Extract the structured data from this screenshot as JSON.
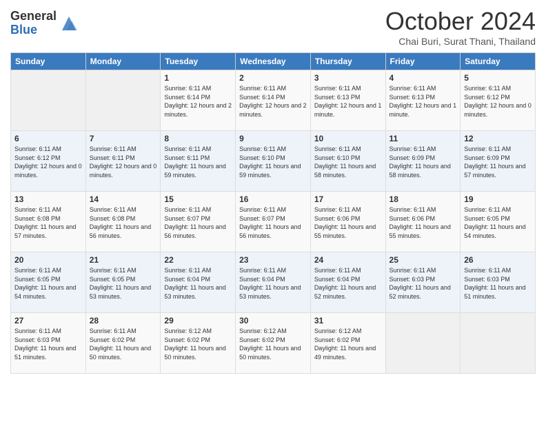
{
  "header": {
    "logo_general": "General",
    "logo_blue": "Blue",
    "month_title": "October 2024",
    "subtitle": "Chai Buri, Surat Thani, Thailand"
  },
  "weekdays": [
    "Sunday",
    "Monday",
    "Tuesday",
    "Wednesday",
    "Thursday",
    "Friday",
    "Saturday"
  ],
  "weeks": [
    [
      {
        "day": "",
        "info": ""
      },
      {
        "day": "",
        "info": ""
      },
      {
        "day": "1",
        "info": "Sunrise: 6:11 AM\nSunset: 6:14 PM\nDaylight: 12 hours and 2 minutes."
      },
      {
        "day": "2",
        "info": "Sunrise: 6:11 AM\nSunset: 6:14 PM\nDaylight: 12 hours and 2 minutes."
      },
      {
        "day": "3",
        "info": "Sunrise: 6:11 AM\nSunset: 6:13 PM\nDaylight: 12 hours and 1 minute."
      },
      {
        "day": "4",
        "info": "Sunrise: 6:11 AM\nSunset: 6:13 PM\nDaylight: 12 hours and 1 minute."
      },
      {
        "day": "5",
        "info": "Sunrise: 6:11 AM\nSunset: 6:12 PM\nDaylight: 12 hours and 0 minutes."
      }
    ],
    [
      {
        "day": "6",
        "info": "Sunrise: 6:11 AM\nSunset: 6:12 PM\nDaylight: 12 hours and 0 minutes."
      },
      {
        "day": "7",
        "info": "Sunrise: 6:11 AM\nSunset: 6:11 PM\nDaylight: 12 hours and 0 minutes."
      },
      {
        "day": "8",
        "info": "Sunrise: 6:11 AM\nSunset: 6:11 PM\nDaylight: 11 hours and 59 minutes."
      },
      {
        "day": "9",
        "info": "Sunrise: 6:11 AM\nSunset: 6:10 PM\nDaylight: 11 hours and 59 minutes."
      },
      {
        "day": "10",
        "info": "Sunrise: 6:11 AM\nSunset: 6:10 PM\nDaylight: 11 hours and 58 minutes."
      },
      {
        "day": "11",
        "info": "Sunrise: 6:11 AM\nSunset: 6:09 PM\nDaylight: 11 hours and 58 minutes."
      },
      {
        "day": "12",
        "info": "Sunrise: 6:11 AM\nSunset: 6:09 PM\nDaylight: 11 hours and 57 minutes."
      }
    ],
    [
      {
        "day": "13",
        "info": "Sunrise: 6:11 AM\nSunset: 6:08 PM\nDaylight: 11 hours and 57 minutes."
      },
      {
        "day": "14",
        "info": "Sunrise: 6:11 AM\nSunset: 6:08 PM\nDaylight: 11 hours and 56 minutes."
      },
      {
        "day": "15",
        "info": "Sunrise: 6:11 AM\nSunset: 6:07 PM\nDaylight: 11 hours and 56 minutes."
      },
      {
        "day": "16",
        "info": "Sunrise: 6:11 AM\nSunset: 6:07 PM\nDaylight: 11 hours and 56 minutes."
      },
      {
        "day": "17",
        "info": "Sunrise: 6:11 AM\nSunset: 6:06 PM\nDaylight: 11 hours and 55 minutes."
      },
      {
        "day": "18",
        "info": "Sunrise: 6:11 AM\nSunset: 6:06 PM\nDaylight: 11 hours and 55 minutes."
      },
      {
        "day": "19",
        "info": "Sunrise: 6:11 AM\nSunset: 6:05 PM\nDaylight: 11 hours and 54 minutes."
      }
    ],
    [
      {
        "day": "20",
        "info": "Sunrise: 6:11 AM\nSunset: 6:05 PM\nDaylight: 11 hours and 54 minutes."
      },
      {
        "day": "21",
        "info": "Sunrise: 6:11 AM\nSunset: 6:05 PM\nDaylight: 11 hours and 53 minutes."
      },
      {
        "day": "22",
        "info": "Sunrise: 6:11 AM\nSunset: 6:04 PM\nDaylight: 11 hours and 53 minutes."
      },
      {
        "day": "23",
        "info": "Sunrise: 6:11 AM\nSunset: 6:04 PM\nDaylight: 11 hours and 53 minutes."
      },
      {
        "day": "24",
        "info": "Sunrise: 6:11 AM\nSunset: 6:04 PM\nDaylight: 11 hours and 52 minutes."
      },
      {
        "day": "25",
        "info": "Sunrise: 6:11 AM\nSunset: 6:03 PM\nDaylight: 11 hours and 52 minutes."
      },
      {
        "day": "26",
        "info": "Sunrise: 6:11 AM\nSunset: 6:03 PM\nDaylight: 11 hours and 51 minutes."
      }
    ],
    [
      {
        "day": "27",
        "info": "Sunrise: 6:11 AM\nSunset: 6:03 PM\nDaylight: 11 hours and 51 minutes."
      },
      {
        "day": "28",
        "info": "Sunrise: 6:11 AM\nSunset: 6:02 PM\nDaylight: 11 hours and 50 minutes."
      },
      {
        "day": "29",
        "info": "Sunrise: 6:12 AM\nSunset: 6:02 PM\nDaylight: 11 hours and 50 minutes."
      },
      {
        "day": "30",
        "info": "Sunrise: 6:12 AM\nSunset: 6:02 PM\nDaylight: 11 hours and 50 minutes."
      },
      {
        "day": "31",
        "info": "Sunrise: 6:12 AM\nSunset: 6:02 PM\nDaylight: 11 hours and 49 minutes."
      },
      {
        "day": "",
        "info": ""
      },
      {
        "day": "",
        "info": ""
      }
    ]
  ]
}
